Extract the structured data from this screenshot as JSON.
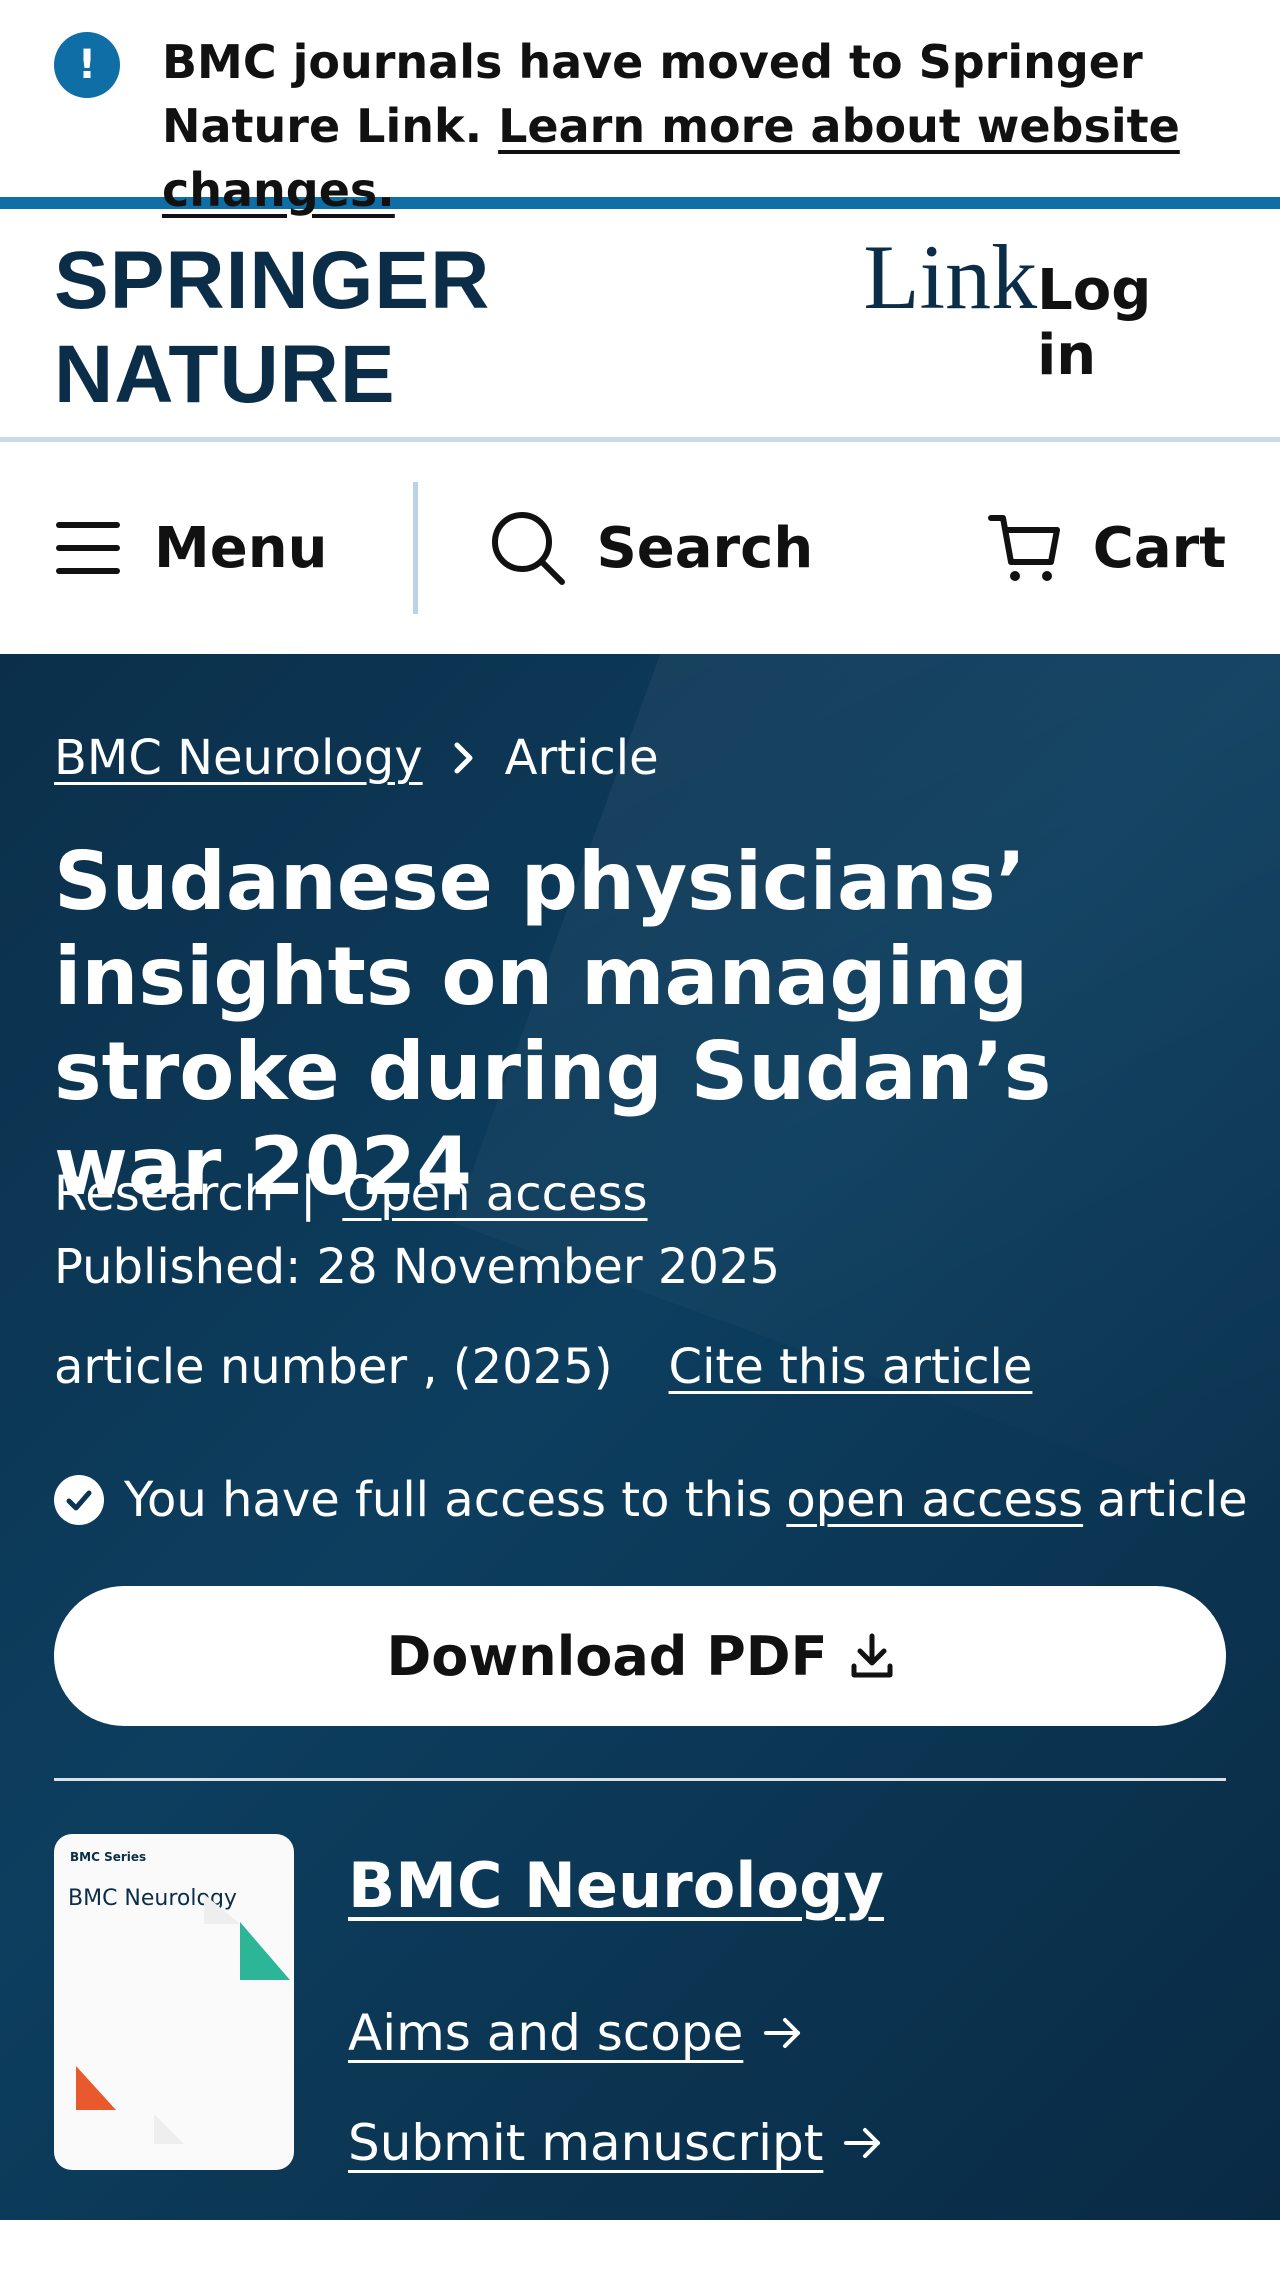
{
  "notice": {
    "lead": "BMC journals have moved to Springer Nature Link.",
    "link": "Learn more about website changes."
  },
  "header": {
    "brand_main": "SPRINGER NATURE",
    "brand_sub": "Link",
    "login": "Log in"
  },
  "nav": {
    "menu": "Menu",
    "search": "Search",
    "cart": "Cart"
  },
  "breadcrumb": {
    "journal": "BMC Neurology",
    "current": "Article"
  },
  "article": {
    "title": "Sudanese physicians’ insights on managing stroke during Sudan’s war 2024",
    "type": "Research",
    "separator": "|",
    "open_access": "Open access",
    "published": "Published: 28 November 2025",
    "article_number": "article number , (2025)",
    "cite": "Cite this article"
  },
  "access": {
    "prefix": "You have full access to this",
    "link": "open access",
    "suffix": "article"
  },
  "download": {
    "label": "Download PDF"
  },
  "journal": {
    "cover_series": "BMC Series",
    "cover_title": "BMC Neurology",
    "name": "BMC Neurology",
    "aims": "Aims and scope",
    "submit": "Submit manuscript"
  },
  "colors": {
    "accent_blue": "#0f6ea6",
    "hero_bg": "#0b3552",
    "brand_navy": "#0b2d48"
  }
}
